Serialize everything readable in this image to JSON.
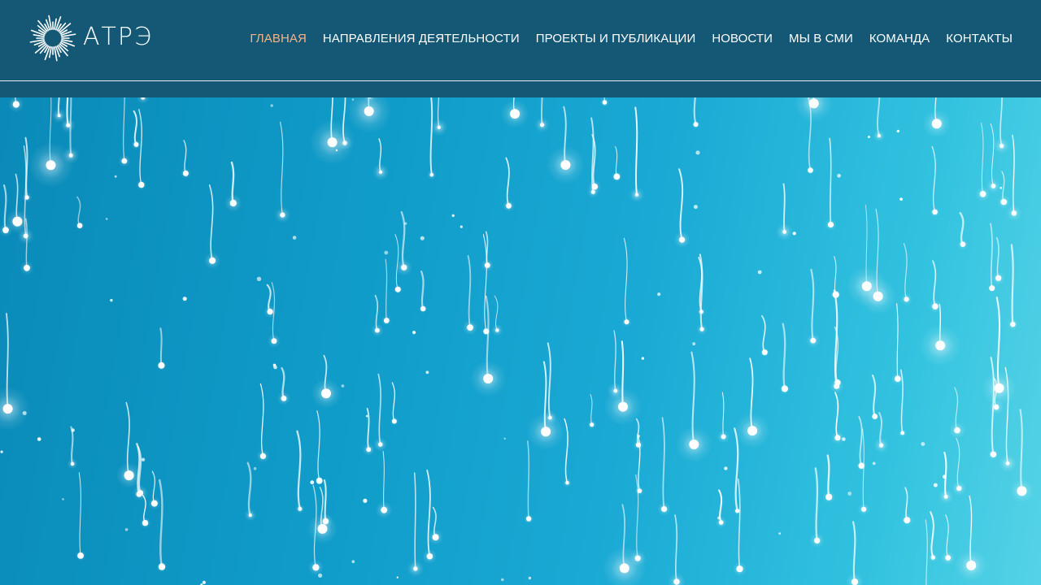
{
  "logo": {
    "text": "АТРЭ",
    "icon": "sunburst-logo-icon"
  },
  "nav": {
    "items": [
      {
        "label": "ГЛАВНАЯ",
        "active": true
      },
      {
        "label": "НАПРАВЛЕНИЯ ДЕЯТЕЛЬНОСТИ",
        "active": false
      },
      {
        "label": "ПРОЕКТЫ И ПУБЛИКАЦИИ",
        "active": false
      },
      {
        "label": "НОВОСТИ",
        "active": false
      },
      {
        "label": "МЫ В СМИ",
        "active": false
      },
      {
        "label": "КОМАНДА",
        "active": false
      },
      {
        "label": "КОНТАКТЫ",
        "active": false
      }
    ]
  },
  "colors": {
    "header_bg": "#145876",
    "active_nav": "#f0b48a",
    "hero_start": "#0a8ab8",
    "hero_end": "#55d3e6"
  },
  "hero": {
    "decoration": "glowing-sperm-particles-background"
  }
}
